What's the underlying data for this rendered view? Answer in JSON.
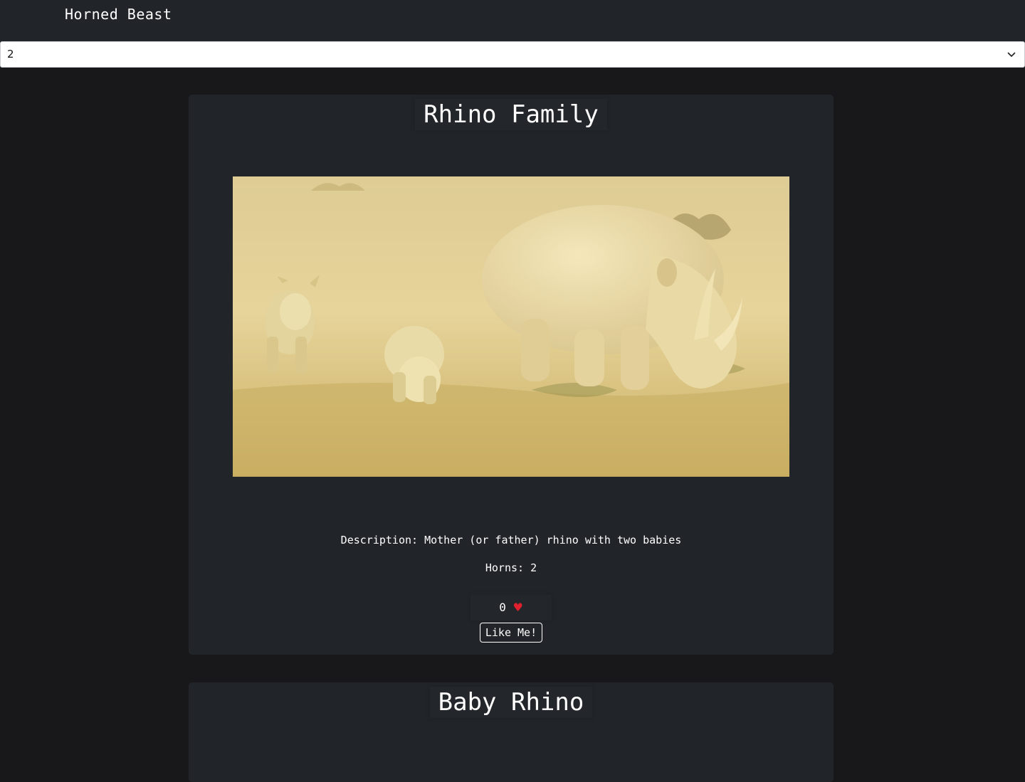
{
  "header": {
    "title": "Horned Beast"
  },
  "filter": {
    "selected_value": "2",
    "icon": "chevron-down-icon"
  },
  "cards": [
    {
      "title": "Rhino Family",
      "description": "Description: Mother (or father) rhino with two babies",
      "horns": "Horns: 2",
      "likes_count": "0",
      "heart": "♥",
      "like_button_label": "Like Me!"
    },
    {
      "title": "Baby Rhino"
    }
  ],
  "colors": {
    "page_background": "#18181a",
    "header_background": "#212429",
    "card_background": "#212429",
    "heart": "#e0202c"
  }
}
